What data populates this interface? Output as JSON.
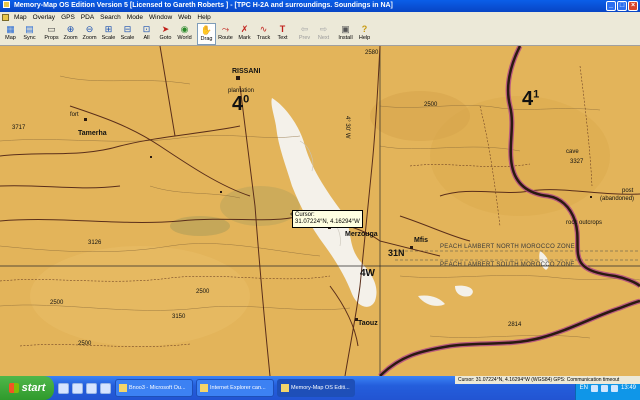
{
  "window": {
    "title": "Memory-Map OS Edition Version 5 [Licensed to Gareth Roberts ] - [TPC H-2A and surroundings. Soundings in NA]"
  },
  "menu": [
    "Map",
    "Overlay",
    "GPS",
    "PDA",
    "Search",
    "Mode",
    "Window",
    "Web",
    "Help"
  ],
  "toolbar": [
    {
      "label": "Map",
      "icon": "map-icon"
    },
    {
      "label": "Sync",
      "icon": "sync-icon"
    },
    {
      "label": "Props",
      "icon": "properties-icon"
    },
    {
      "label": "Zoom",
      "icon": "zoom-icon"
    },
    {
      "label": "Zoom",
      "icon": "zoom-out-icon"
    },
    {
      "label": "Scale",
      "icon": "scale-icon"
    },
    {
      "label": "Scale",
      "icon": "scale-down-icon"
    },
    {
      "label": "All",
      "icon": "zoom-all-icon"
    },
    {
      "label": "Goto",
      "icon": "goto-icon"
    },
    {
      "label": "World",
      "icon": "world-icon"
    },
    {
      "label": "Drag",
      "icon": "hand-icon",
      "active": true
    },
    {
      "label": "Route",
      "icon": "route-icon"
    },
    {
      "label": "Mark",
      "icon": "mark-icon"
    },
    {
      "label": "Track",
      "icon": "track-icon"
    },
    {
      "label": "Text",
      "icon": "text-icon"
    },
    {
      "label": "Prev",
      "icon": "prev-icon",
      "disabled": true
    },
    {
      "label": "Next",
      "icon": "next-icon",
      "disabled": true
    },
    {
      "label": "Install",
      "icon": "install-icon"
    },
    {
      "label": "Help",
      "icon": "help-icon"
    }
  ],
  "map": {
    "labels": {
      "rissani": "RISSANI",
      "plantation": "plantation",
      "grid40": "4",
      "grid40_sup": "0",
      "tamerha": "Tamerha",
      "fort": "fort",
      "h3717": "3717",
      "merzouga": "Merzouga",
      "h3126": "3126",
      "h3150": "3150",
      "h2500a": "2500",
      "h2500b": "2500",
      "h2500c": "2500",
      "h2500d": "2500",
      "mfis": "Mfis",
      "grid31n": "31N",
      "grid4w": "4W",
      "taouz": "Taouz",
      "h2814": "2814",
      "grid41": "4",
      "grid41_sup": "1",
      "cave": "cave",
      "h3327": "3327",
      "post": "post",
      "abandoned": "(abandoned)",
      "rock_outcrops": "rock outcrops",
      "zone_north": "PEACH LAMBERT NORTH MOROCCO ZONE",
      "zone_south": "PEACH LAMBERT SOUTH MOROCCO ZONE",
      "lon_label": "4° 30' W",
      "h2580": "2580"
    },
    "tooltip": {
      "line1": "Cursor:",
      "line2": "31.07224°N, 4.16294°W"
    }
  },
  "status": {
    "text": "Cursor: 31.07224°N, 4.16294°W (WGS84)   GPS: Communication timeout"
  },
  "taskbar": {
    "start_label": "start",
    "tasks": [
      {
        "label": "Bnoo3 - Microsoft Ou..."
      },
      {
        "label": "Internet Explorer can..."
      },
      {
        "label": "Memory-Map OS Editi...",
        "active": true
      }
    ],
    "tray_lang": "EN",
    "clock": "13:49"
  },
  "colors": {
    "map_background": "#e3b45a",
    "road": "#5a2e1a",
    "border": "#2a1a10",
    "border_casing": "#b14a84",
    "sand": "#f4f1ea"
  }
}
